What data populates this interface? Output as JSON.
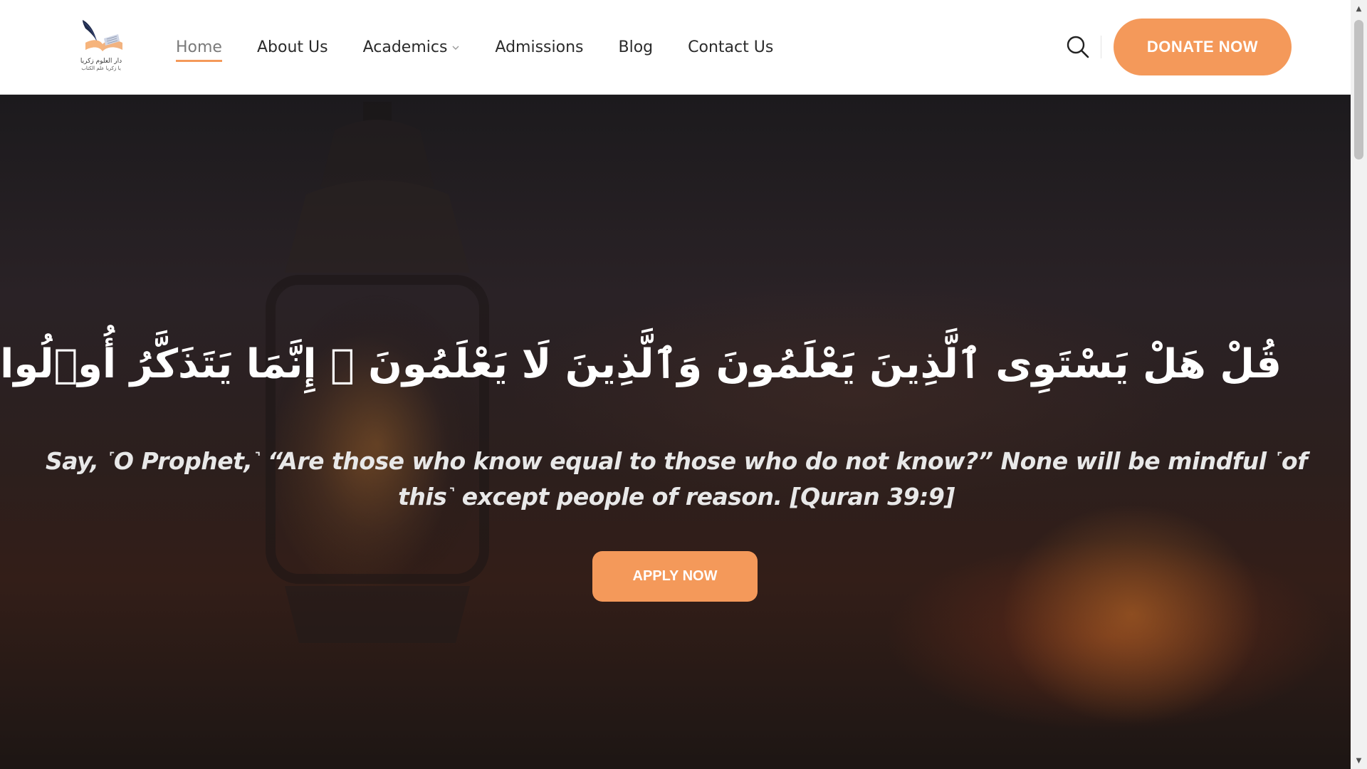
{
  "colors": {
    "accent": "#f4995a",
    "header_bg": "#ffffff",
    "hero_text": "#ffffff"
  },
  "logo": {
    "line1": "دار العلوم زكريا",
    "line2": "يا زكريا علم الكتاب"
  },
  "nav": {
    "items": [
      {
        "label": "Home",
        "active": true
      },
      {
        "label": "About Us"
      },
      {
        "label": "Academics",
        "has_dropdown": true,
        "icon": "chevron-down-icon"
      },
      {
        "label": "Admissions"
      },
      {
        "label": "Blog"
      },
      {
        "label": "Contact Us"
      }
    ]
  },
  "header": {
    "search_icon": "search-icon",
    "donate_label": "DONATE NOW"
  },
  "hero": {
    "arabic_verse": "قُلْ هَلْ يَسْتَوِى ٱلَّذِينَ يَعْلَمُونَ وَٱلَّذِينَ لَا يَعْلَمُونَ ۗ إِنَّمَا يَتَذَكَّرُ أُو۟لُوا۟ ٱلْأَلْبَـٰبِ",
    "translation": "Say, ˹O Prophet,˺ “Are those who know equal to those who do not know?” None will be mindful ˹of this˺ except people of reason. [Quran 39:9]",
    "apply_label": "APPLY NOW",
    "background_icon": "lantern-icon"
  },
  "scrollbar": {
    "up_icon": "▲",
    "down_icon": "▼"
  }
}
